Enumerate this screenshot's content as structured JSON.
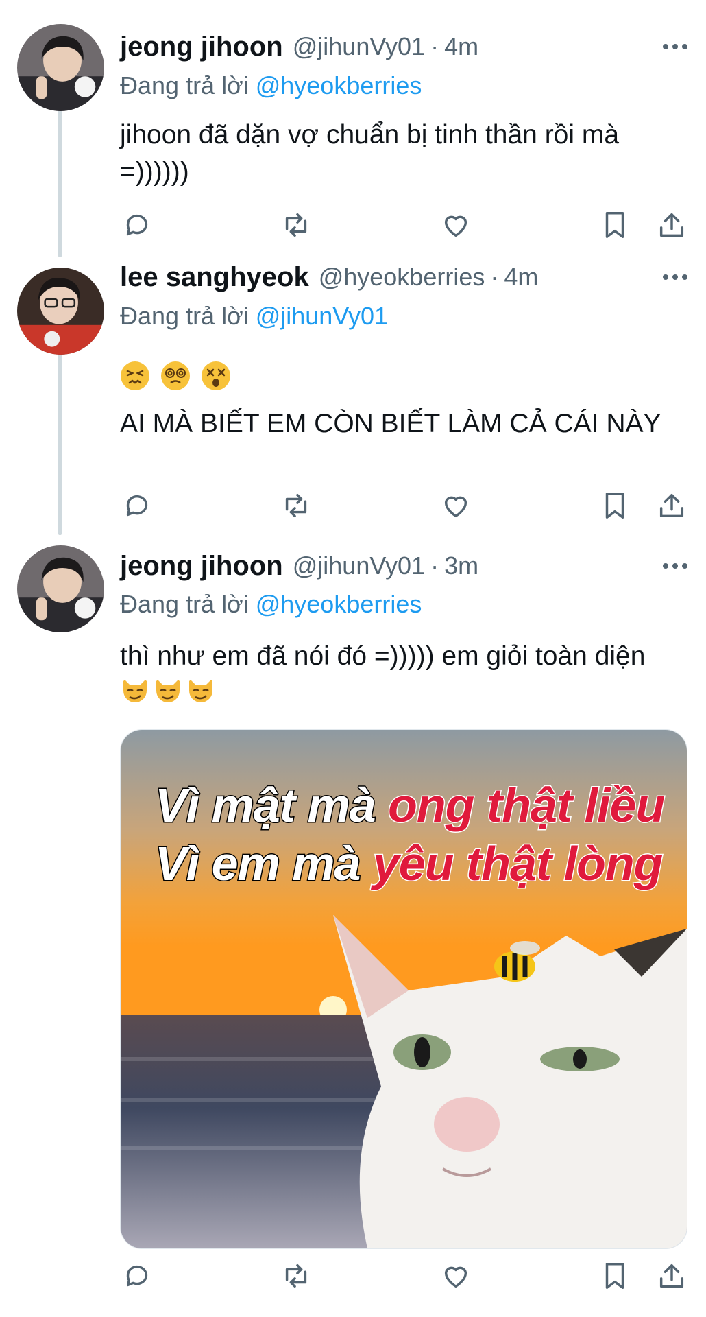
{
  "tweets": [
    {
      "name": "jeong jihoon",
      "handle": "@jihunVy01",
      "separator": "·",
      "time": "4m",
      "reply_prefix": "Đang trả lời",
      "reply_to": "@hyeokberries",
      "text": "jihoon đã dặn vợ chuẩn bị tinh thần rồi mà =))))))"
    },
    {
      "name": "lee sanghyeok",
      "handle": "@hyeokberries",
      "separator": "·",
      "time": "4m",
      "reply_prefix": "Đang trả lời",
      "reply_to": "@jihunVy01",
      "emojis": [
        "confounded-face",
        "dizzy-spiral-face",
        "dizzy-cross-eyes-face"
      ],
      "text": "AI MÀ BIẾT EM CÒN BIẾT LÀM CẢ CÁI NÀY"
    },
    {
      "name": "jeong jihoon",
      "handle": "@jihunVy01",
      "separator": "·",
      "time": "3m",
      "reply_prefix": "Đang trả lời",
      "reply_to": "@hyeokberries",
      "text": "thì như em đã nói đó =))))) em giỏi toàn diện",
      "emojis": [
        "smirking-cat-face",
        "smirking-cat-face",
        "smirking-cat-face"
      ],
      "media": {
        "line1_white": "Vì mật mà",
        "line1_red": "ong thật liều",
        "line2_white": "Vì em  mà",
        "line2_red": "yêu thật lòng"
      }
    }
  ],
  "icons": {
    "more": "more-horizontal-icon",
    "reply": "reply-bubble-icon",
    "retweet": "retweet-icon",
    "like": "heart-icon",
    "bookmark": "bookmark-icon",
    "share": "share-icon"
  },
  "colors": {
    "mention": "#1d9bf0",
    "secondary_text": "#536471",
    "thread_line": "#cfd9de",
    "caption_red": "#e01a3c"
  }
}
